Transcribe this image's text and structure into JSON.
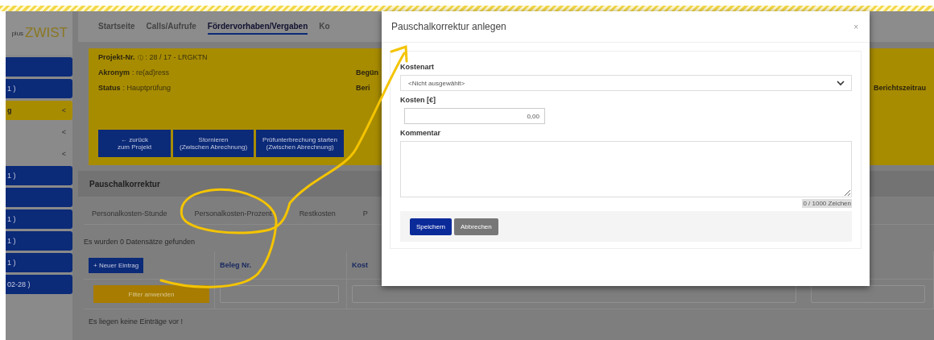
{
  "sidebar": {
    "logo": {
      "prefix": "plus",
      "name": "ZWIST"
    },
    "items": [
      {
        "kind": "button",
        "selected": false
      },
      {
        "kind": "button",
        "label": "1 )",
        "selected": false
      },
      {
        "kind": "button",
        "label": "g",
        "caret": "<",
        "selected": true
      },
      {
        "kind": "group",
        "caret": "<",
        "selected": false
      },
      {
        "kind": "group",
        "caret": "<",
        "selected": false
      },
      {
        "kind": "button",
        "label": "1 )",
        "selected": false
      },
      {
        "kind": "button",
        "selected": false
      },
      {
        "kind": "button",
        "label": "1 )",
        "selected": false
      },
      {
        "kind": "button",
        "label": "1 )",
        "selected": false
      },
      {
        "kind": "button",
        "label": "1 )",
        "selected": false
      },
      {
        "kind": "button",
        "label": "02-28 )",
        "selected": false
      }
    ]
  },
  "nav": {
    "tabs": [
      {
        "label": "Startseite",
        "selected": false
      },
      {
        "label": "Calls/Aufrufe",
        "selected": false
      },
      {
        "label": "Fördervorhaben/Vergaben",
        "selected": true
      },
      {
        "label": "Ko",
        "selected": false
      }
    ]
  },
  "project": {
    "number_label": "Projekt-Nr.",
    "info_mark": "ⓘ",
    "number": ": 28 / 17 - LRGKTN",
    "fields": [
      {
        "label": "Akronym",
        "value": ": re(ad)ress"
      },
      {
        "label": "Status",
        "value": ": Hauptprüfung"
      }
    ],
    "middle_labels": [
      "Begün",
      "Beri"
    ],
    "right_label": "Berichtszeitrau",
    "buttons": [
      {
        "lines": [
          "← zurück",
          "zum Projekt"
        ]
      },
      {
        "lines": [
          "Stornieren",
          "(Zwischen Abrechnung)"
        ]
      },
      {
        "lines": [
          "Prüfunterbrechung starten",
          "(Zwischen Abrechnung)"
        ]
      }
    ]
  },
  "card": {
    "title": "Pauschalkorrektur",
    "tabs": [
      {
        "label": "Personalkosten-Stunde",
        "selected": false
      },
      {
        "label": "Personalkosten-Prozent",
        "selected": false
      },
      {
        "label": "Restkosten",
        "selected": false
      },
      {
        "label": "P",
        "selected": false
      }
    ],
    "result_text": "Es wurden 0 Datensätze gefunden",
    "new_button": "+ Neuer Eintrag",
    "columns": [
      "Beleg Nr.",
      "Kost"
    ],
    "filter_button": "Filter anwenden",
    "empty_text": "Es liegen keine Einträge vor !"
  },
  "dialog": {
    "title": "Pauschalkorrektur anlegen",
    "close": "×",
    "cost_type": {
      "label": "Kostenart",
      "value": "<Nicht ausgewählt>"
    },
    "cost": {
      "label": "Kosten [€]",
      "value": "0,00"
    },
    "comment": {
      "label": "Kommentar",
      "counter": "0 / 1000 Zeichen"
    },
    "buttons": [
      {
        "label": "Speichern",
        "kind": "primary"
      },
      {
        "label": "Abbrechen",
        "kind": "secondary"
      }
    ]
  }
}
